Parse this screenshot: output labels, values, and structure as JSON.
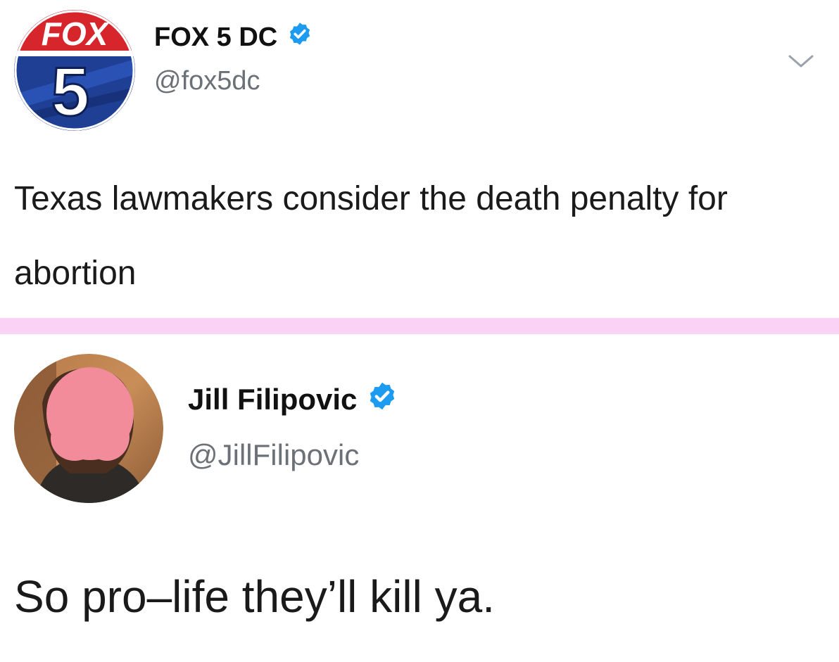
{
  "tweets": [
    {
      "display_name": "FOX 5 DC",
      "handle": "@fox5dc",
      "verified": true,
      "avatar_icon": "fox5-logo-icon",
      "avatar_logo_text": "FOX",
      "avatar_logo_number": "5",
      "text": "Texas lawmakers consider the death penalty for abortion"
    },
    {
      "display_name": "Jill Filipovic",
      "handle": "@JillFilipovic",
      "verified": true,
      "avatar_icon": "profile-photo-blurred-face",
      "text": "So pro–life they’ll kill ya."
    }
  ],
  "colors": {
    "verified_blue": "#1d9bf0",
    "divider_pink": "#f9d2f5",
    "handle_gray": "#6b7177",
    "fox_red": "#d6262b",
    "fox_blue": "#1e3f94",
    "face_censor_pink": "#f28c9b"
  },
  "icons": {
    "verified": "verified-badge-icon",
    "more": "chevron-down-icon"
  }
}
